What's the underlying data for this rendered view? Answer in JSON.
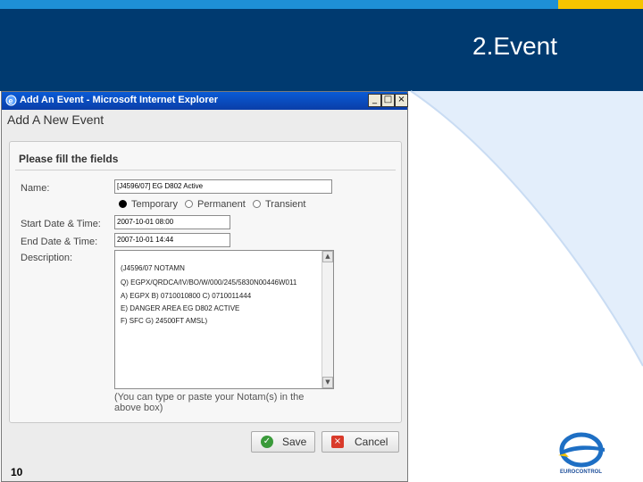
{
  "slide": {
    "title": "2.Event",
    "page_number": "10",
    "logo_text": "EUROCONTROL"
  },
  "browser": {
    "window_title": "Add An Event - Microsoft Internet Explorer",
    "min_glyph": "_",
    "max_glyph": "□",
    "close_glyph": "×"
  },
  "page": {
    "heading": "Add A New Event"
  },
  "form": {
    "panel_heading": "Please fill the fields",
    "name_label": "Name:",
    "name_value": "[J4596/07] EG D802 Active",
    "type_options": [
      "Temporary",
      "Permanent",
      "Transient"
    ],
    "type_selected": "Temporary",
    "start_label": "Start Date & Time:",
    "start_value": "2007-10-01 08:00",
    "end_label": "End Date & Time:",
    "end_value": "2007-10-01 14:44",
    "description_label": "Description:",
    "description_lines": [
      "(J4596/07 NOTAMN",
      "Q) EGPX/QRDCA/IV/BO/W/000/245/5830N00446W011",
      "A) EGPX B) 0710010800 C) 0710011444",
      "E) DANGER AREA EG D802 ACTIVE",
      "F) SFC G) 24500FT AMSL)"
    ],
    "hint": "(You can type or paste your Notam(s) in the above box)",
    "save_label": "Save",
    "cancel_label": "Cancel"
  },
  "colors": {
    "header_band": "#003a70",
    "top_stripe": "#1e8fd6",
    "accent_gold": "#f6c400"
  },
  "icons": {
    "ie": "internet-explorer-icon",
    "save": "check-icon",
    "cancel": "x-icon",
    "logo": "eurocontrol-logo"
  }
}
